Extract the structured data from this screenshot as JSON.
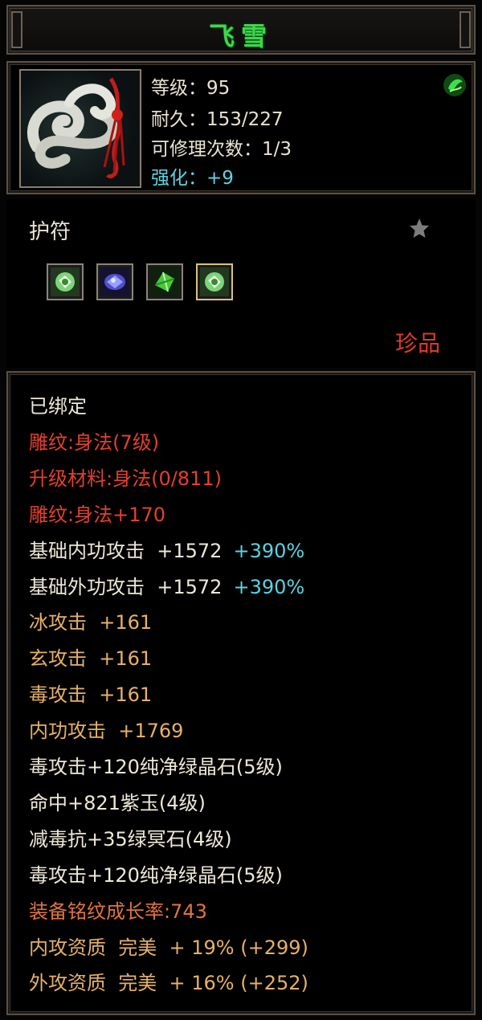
{
  "item": {
    "name": "飞雪",
    "level_label": "等级",
    "level_value": "95",
    "durability_label": "耐久",
    "durability_value": "153/227",
    "repair_label": "可修理次数",
    "repair_value": "1/3",
    "enhance_label": "强化",
    "enhance_value": "+9",
    "colon": "：",
    "category": "护符",
    "rarity": "珍品"
  },
  "icons": {
    "main": "jade-cloud-amulet-icon",
    "badge": "green-gem-badge-icon",
    "favorite": "star-icon",
    "slots": [
      "green-gem-icon",
      "purple-gem-icon",
      "green-crystal-icon",
      "green-gem-icon"
    ]
  },
  "colors": {
    "title": "#3fd64a",
    "red": "#e2402e",
    "orange": "#e6b168",
    "cyan": "#58d4e3",
    "white": "#eee8d8"
  },
  "attributes": [
    {
      "text": "已绑定",
      "color": "w"
    },
    {
      "text": "雕纹:身法(7级)",
      "color": "r"
    },
    {
      "text": "升级材料:身法(0/811)",
      "color": "r"
    },
    {
      "text": "雕纹:身法+170",
      "color": "r"
    },
    {
      "text": "基础内功攻击  +1572",
      "extra": "+390%",
      "color": "w"
    },
    {
      "text": "基础外功攻击  +1572",
      "extra": "+390%",
      "color": "w"
    },
    {
      "text": "冰攻击  +161",
      "color": "o"
    },
    {
      "text": "玄攻击  +161",
      "color": "o"
    },
    {
      "text": "毒攻击  +161",
      "color": "o"
    },
    {
      "text": "内功攻击  +1769",
      "color": "o"
    },
    {
      "text": "毒攻击+120纯净绿晶石(5级)",
      "color": "w"
    },
    {
      "text": "命中+821紫玉(4级)",
      "color": "w"
    },
    {
      "text": "减毒抗+35绿冥石(4级)",
      "color": "w"
    },
    {
      "text": "毒攻击+120纯净绿晶石(5级)",
      "color": "w"
    },
    {
      "text": "装备铭纹成长率:743",
      "color": "ro"
    },
    {
      "text": "内攻资质  完美  + 19% (+299)",
      "color": "o"
    },
    {
      "text": "外攻资质  完美  + 16% (+252)",
      "color": "o"
    }
  ]
}
